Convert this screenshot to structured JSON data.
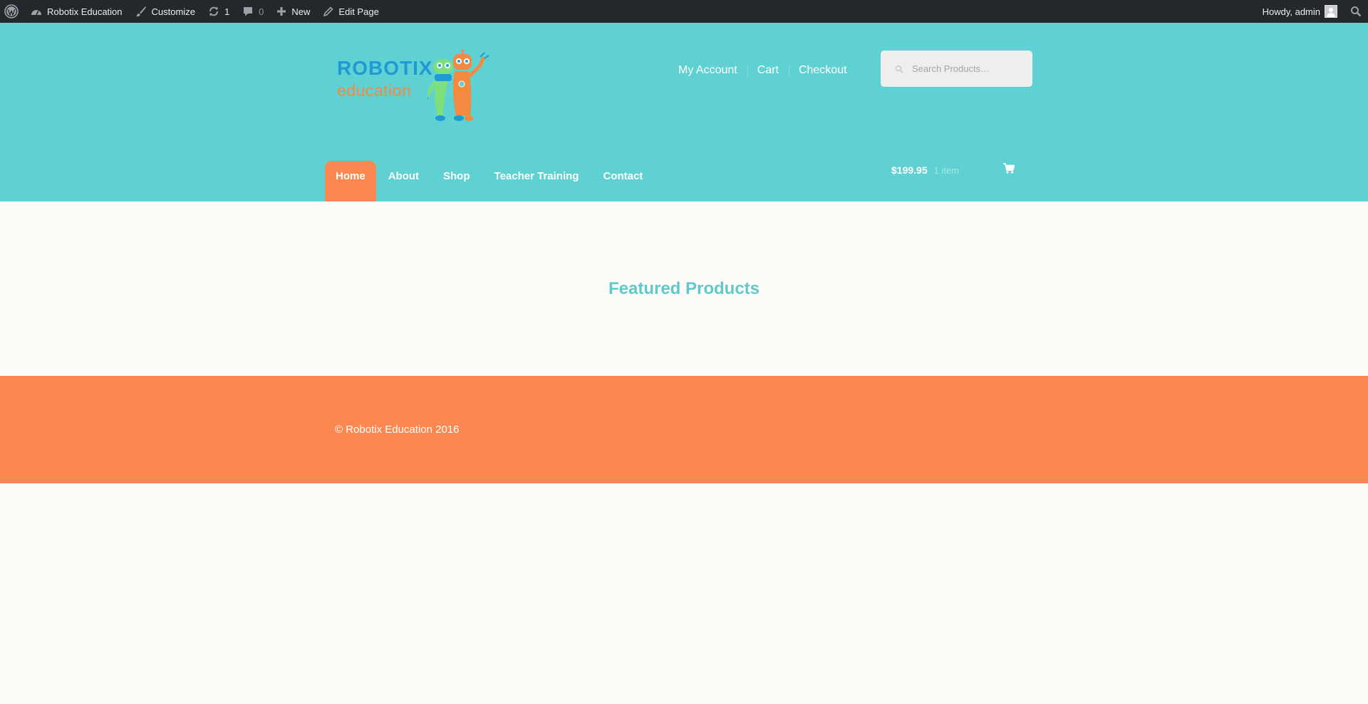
{
  "admin_bar": {
    "site_name": "Robotix Education",
    "customize": "Customize",
    "updates_count": "1",
    "comments_count": "0",
    "new": "New",
    "edit_page": "Edit Page",
    "howdy": "Howdy, admin"
  },
  "header": {
    "logo": {
      "word1": "ROBOTIX",
      "word2": "education"
    },
    "links": [
      "My Account",
      "Cart",
      "Checkout"
    ],
    "search_placeholder": "Search Products…",
    "nav": [
      "Home",
      "About",
      "Shop",
      "Teacher Training",
      "Contact"
    ],
    "active_nav": "Home",
    "cart": {
      "amount": "$199.95",
      "items": "1 item"
    }
  },
  "main": {
    "section_title": "Featured Products"
  },
  "footer": {
    "copyright": "© Robotix Education 2016"
  },
  "colors": {
    "admin_bar": "#23282d",
    "header": "#60d1d2",
    "accent": "#fb8850",
    "title": "#60c9cc",
    "background": "#fefcf9"
  }
}
